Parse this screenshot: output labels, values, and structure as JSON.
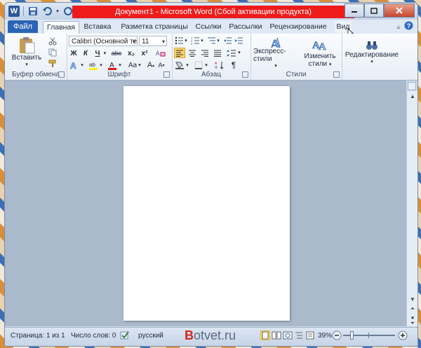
{
  "window": {
    "title": "Документ1 - Microsoft Word (Сбой активации продукта)",
    "accent_color": "#2b64b5",
    "title_highlight_color": "#ef1b1b"
  },
  "quick_access": {
    "logo_letter": "W"
  },
  "tabs": {
    "file": "Файл",
    "items": [
      "Главная",
      "Вставка",
      "Разметка страницы",
      "Ссылки",
      "Рассылки",
      "Рецензирование",
      "Вид"
    ],
    "active": "Главная"
  },
  "ribbon": {
    "clipboard": {
      "label": "Буфер обмена",
      "paste": "Вставить"
    },
    "font": {
      "label": "Шрифт",
      "font_name": "Calibri (Основной тек",
      "font_size": "11",
      "bold": "Ж",
      "italic": "К",
      "underline": "Ч",
      "strike": "abc",
      "subscript": "x₂",
      "superscript": "x²",
      "change_case": "Aa",
      "grow": "A",
      "shrink": "A"
    },
    "paragraph": {
      "label": "Абзац",
      "show_marks": "¶"
    },
    "styles": {
      "label": "Стили",
      "quick_styles": "Экспресс-стили",
      "change_styles_1": "Изменить",
      "change_styles_2": "стили"
    },
    "editing": {
      "label": "Редактирование"
    }
  },
  "status_bar": {
    "page": "Страница: 1 из 1",
    "words": "Число слов: 0",
    "language": "русский",
    "zoom": "39%",
    "zoom_value": 39
  },
  "watermark": {
    "first": "B",
    "rest": "otvet.ru"
  }
}
